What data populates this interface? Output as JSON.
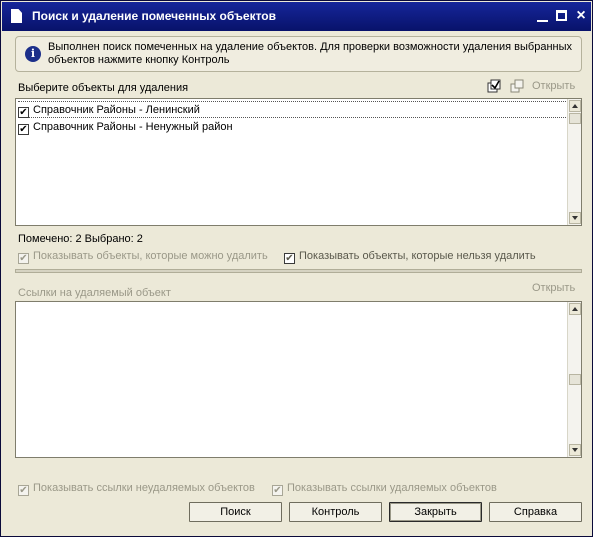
{
  "window": {
    "title": "Поиск и удаление помеченных объектов",
    "close_glyph": "×"
  },
  "info": {
    "icon": "info-icon",
    "icon_glyph": "i",
    "message": "Выполнен поиск помеченных на удаление объектов. Для проверки возможности удаления выбранных объектов нажмите кнопку Контроль"
  },
  "objects_section": {
    "label": "Выберите объекты для удаления",
    "open_label": "Открыть",
    "items": [
      {
        "label": "Справочник Районы - Ленинский",
        "checked": true,
        "selected": true
      },
      {
        "label": "Справочник Районы - Ненужный район",
        "checked": true,
        "selected": false
      }
    ]
  },
  "status": {
    "text": "Помечено: 2  Выбрано: 2"
  },
  "filters_top": {
    "can_delete_label": "Показывать объекты, которые можно удалить",
    "can_delete_checked": true,
    "cannot_delete_label": "Показывать объекты, которые нельзя удалить",
    "cannot_delete_checked": true
  },
  "references_section": {
    "label": "Ссылки на удаляемый объект",
    "open_label": "Открыть"
  },
  "filters_bottom": {
    "non_deletable_refs_label": "Показывать ссылки неудаляемых объектов",
    "non_deletable_refs_checked": true,
    "deletable_refs_label": "Показывать ссылки удаляемых объектов",
    "deletable_refs_checked": true
  },
  "buttons": {
    "search": "Поиск",
    "control": "Контроль",
    "close": "Закрыть",
    "help": "Справка"
  },
  "check_glyph": "✔"
}
